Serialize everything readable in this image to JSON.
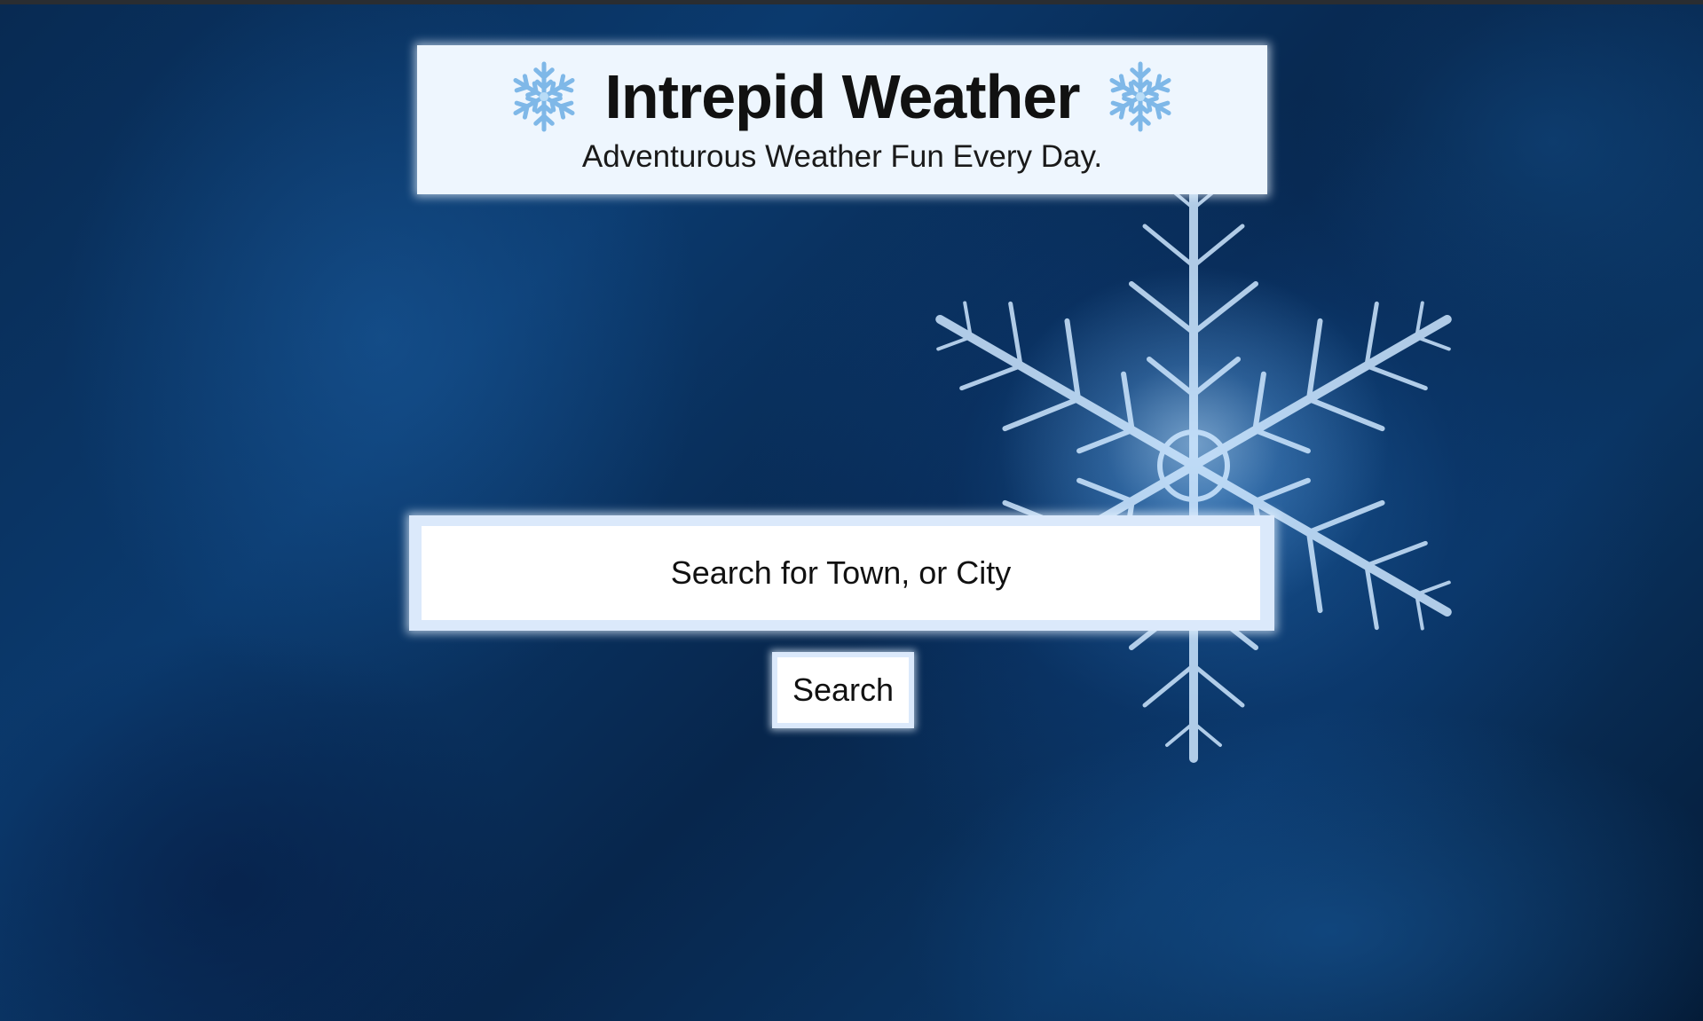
{
  "header": {
    "title": "Intrepid Weather",
    "subtitle": "Adventurous Weather Fun Every Day.",
    "left_icon": "snowflake-icon",
    "right_icon": "snowflake-icon"
  },
  "search": {
    "placeholder": "Search for Town, or City",
    "value": "",
    "button_label": "Search"
  },
  "background": {
    "subject": "snowflake-crystal",
    "accent_color": "#0b3a6e"
  },
  "colors": {
    "card_background": "#eef6fe",
    "input_border": "#dbe9fb",
    "text": "#111111"
  }
}
